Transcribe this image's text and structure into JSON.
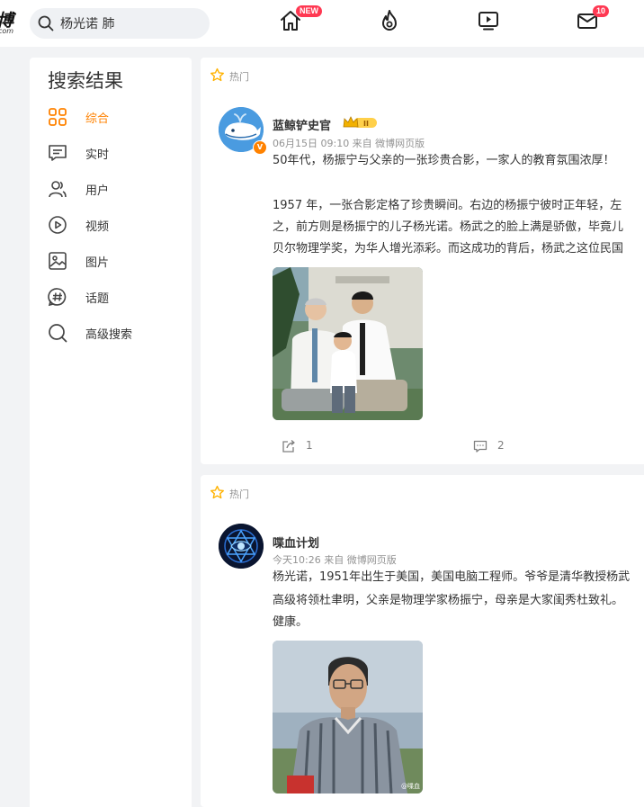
{
  "header": {
    "logo_text": "博",
    "logo_subtext": "com",
    "search_value": "杨光诺 肺",
    "nav": [
      {
        "name": "home-icon",
        "badge": "NEW"
      },
      {
        "name": "hot-icon",
        "badge": ""
      },
      {
        "name": "video-icon",
        "badge": ""
      },
      {
        "name": "mail-icon",
        "badge": "10"
      }
    ]
  },
  "sidebar": {
    "title": "搜索结果",
    "active_color": "#ff8200",
    "items": [
      {
        "label": "综合",
        "icon": "grid-icon",
        "active": true
      },
      {
        "label": "实时",
        "icon": "chat-icon",
        "active": false
      },
      {
        "label": "用户",
        "icon": "user-icon",
        "active": false
      },
      {
        "label": "视频",
        "icon": "play-icon",
        "active": false
      },
      {
        "label": "图片",
        "icon": "image-icon",
        "active": false
      },
      {
        "label": "话题",
        "icon": "hashtag-icon",
        "active": false
      },
      {
        "label": "高级搜索",
        "icon": "search-icon",
        "active": false
      }
    ]
  },
  "posts": [
    {
      "tag": "热门",
      "user": "蓝鲸铲史官",
      "meta": "06月15日 09:10  来自 微博网页版",
      "lines": [
        "50年代，杨振宁与父亲的一张珍贵合影，一家人的教育氛围浓厚！",
        "",
        "1957 年，一张合影定格了珍贵瞬间。右边的杨振宁彼时正年轻，左",
        "之，前方则是杨振宁的儿子杨光诺。杨武之的脸上满是骄傲，毕竟儿",
        "贝尔物理学奖，为华人增光添彩。而这成功的背后，杨武之这位民国"
      ],
      "repost_count": "1",
      "comment_count": "2"
    },
    {
      "tag": "热门",
      "user": "喋血计划",
      "meta": "今天10:26  来自 微博网页版",
      "lines": [
        "杨光诺，1951年出生于美国，美国电脑工程师。爷爷是清华教授杨武",
        "高级将领杜聿明，父亲是物理学家杨振宁，母亲是大家闺秀杜致礼。",
        "健康。"
      ],
      "watermark": "@喋血"
    }
  ]
}
